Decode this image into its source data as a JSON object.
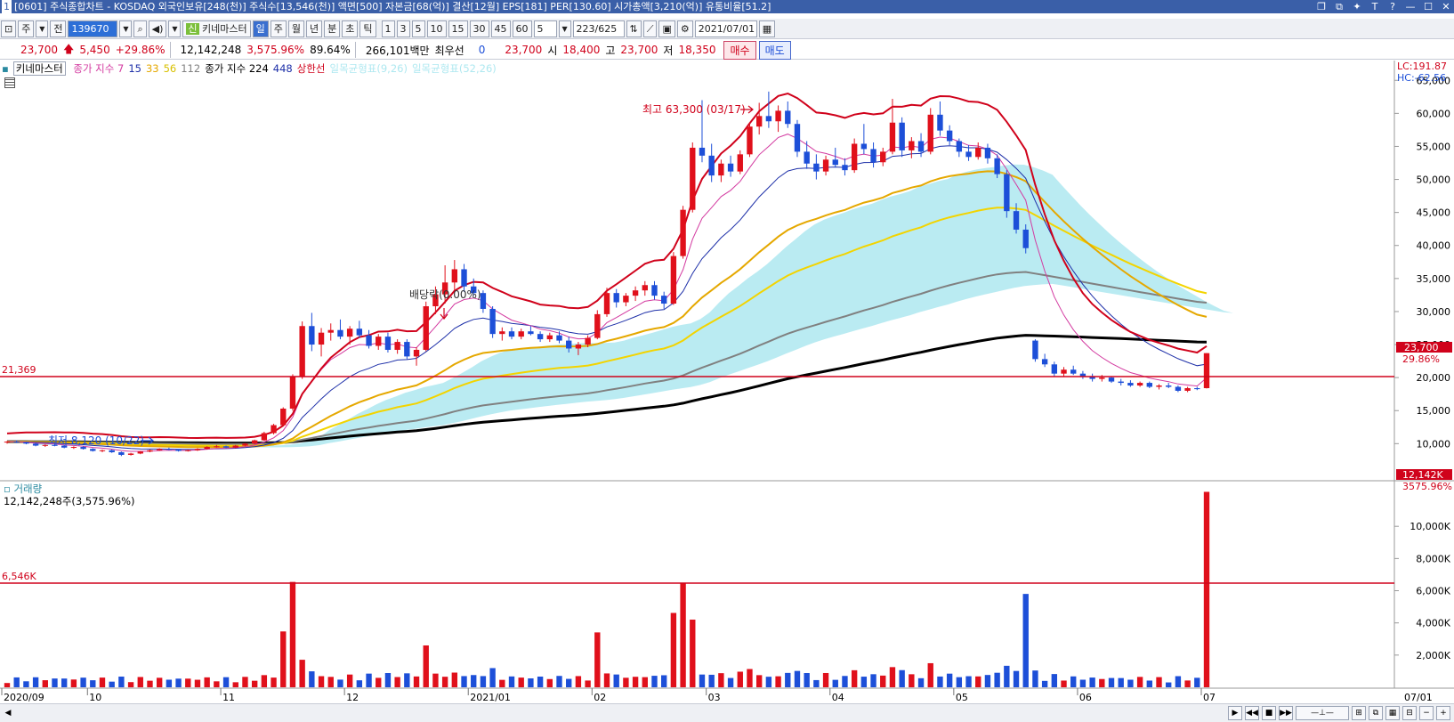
{
  "title_bar": {
    "text": "[0601] 주식종합차트 - KOSDAQ 외국인보유[248(천)] 주식수[13,546(천)] 액면[500] 자본금[68(억)] 결산[12월] EPS[181] PER[130.60] 시가총액[3,210(억)] 유통비율[51.2]",
    "icon": "1"
  },
  "toolbar": {
    "period_label": "주",
    "mode_label": "전",
    "stock_code": "139670",
    "indicator_label": "키네마스터",
    "timeframes": [
      "일",
      "주",
      "월",
      "년",
      "분",
      "초",
      "틱"
    ],
    "active_timeframe": "일",
    "intervals": [
      "1",
      "3",
      "5",
      "10",
      "15",
      "30",
      "45",
      "60"
    ],
    "count_value": "5",
    "range_text": "223/625",
    "date_value": "2021/07/01"
  },
  "quote": {
    "price": "23,700",
    "change": "5,450",
    "change_pct": "+29.86%",
    "volume": "12,142,248",
    "vol_ratio": "3,575.96%",
    "ratio2": "89.64%",
    "amount": "266,101백만",
    "preferred_label": "최우선",
    "preferred_value": "0",
    "current": "23,700",
    "open_label": "시",
    "open": "18,400",
    "high_label": "고",
    "high": "23,700",
    "low_label": "저",
    "low": "18,350",
    "buy_label": "매수",
    "sell_label": "매도"
  },
  "legend": {
    "name": "키네마스터",
    "ma_label": "종가 지수 7",
    "ma15": "15",
    "ma33": "33",
    "ma56": "56",
    "ma112": "112",
    "ma_long_label": "종가 지수 224",
    "ma448": "448",
    "upper_limit_label": "상한선",
    "ichimoku1": "일목균형표(9,26)",
    "ichimoku2": "일목균형표(52,26)",
    "colors": {
      "ma7": "#d33aa0",
      "ma15": "#1d2fa8",
      "ma33": "#e5a800",
      "ma56": "#f3d400",
      "ma112": "#808080",
      "ma224": "#000000",
      "upper": "#d0021b",
      "ichimoku": "#aee8f0"
    }
  },
  "price_axis": {
    "ticks": [
      "65,000",
      "60,000",
      "55,000",
      "50,000",
      "45,000",
      "40,000",
      "35,000",
      "30,000",
      "25,000",
      "20,000",
      "15,000",
      "10,000"
    ],
    "lc": "LC:191.87",
    "hc": "HC:-62.56",
    "current_tag": "23,700",
    "pct_tag": "29.86%",
    "level_line": "21,369"
  },
  "annotations": {
    "high": "최고 63,300 (03/17)",
    "low": "최저 8,120 (10/22)",
    "dividend": "배당락(0.00%)"
  },
  "volume": {
    "label": "거래량",
    "value": "12,142,248주(3,575.96%)",
    "level_line": "6,546K",
    "ticks": [
      "10,000K",
      "8,000K",
      "6,000K",
      "4,000K",
      "2,000K"
    ],
    "current_tag": "12,142K",
    "pct_tag": "3575.96%"
  },
  "x_axis": {
    "labels": [
      "2020/09",
      "10",
      "11",
      "12",
      "2021/01",
      "02",
      "03",
      "04",
      "05",
      "06",
      "07"
    ],
    "right_label": "07/01"
  },
  "chart_data": {
    "type": "candlestick",
    "ylim": [
      6000,
      68000
    ],
    "volume_ylim": [
      0,
      12500
    ],
    "candles": [
      [
        10200,
        10400,
        10000,
        10300
      ],
      [
        10300,
        10500,
        10100,
        10200
      ],
      [
        10200,
        10300,
        9900,
        10000
      ],
      [
        10000,
        10100,
        9600,
        9700
      ],
      [
        9700,
        9900,
        9500,
        9800
      ],
      [
        9800,
        10000,
        9600,
        9700
      ],
      [
        9700,
        9800,
        9300,
        9400
      ],
      [
        9400,
        9600,
        9200,
        9500
      ],
      [
        9500,
        9600,
        9100,
        9200
      ],
      [
        9200,
        9300,
        8800,
        8900
      ],
      [
        8900,
        9100,
        8700,
        9000
      ],
      [
        9000,
        9100,
        8600,
        8700
      ],
      [
        8700,
        8800,
        8120,
        8300
      ],
      [
        8300,
        8600,
        8200,
        8500
      ],
      [
        8500,
        8900,
        8400,
        8800
      ],
      [
        8800,
        9100,
        8700,
        9000
      ],
      [
        9000,
        9300,
        8900,
        9200
      ],
      [
        9200,
        9400,
        9000,
        9100
      ],
      [
        9100,
        9200,
        8800,
        8900
      ],
      [
        8900,
        9100,
        8800,
        9000
      ],
      [
        9000,
        9300,
        8900,
        9200
      ],
      [
        9200,
        9600,
        9100,
        9500
      ],
      [
        9500,
        9800,
        9400,
        9600
      ],
      [
        9600,
        9700,
        9300,
        9400
      ],
      [
        9400,
        9800,
        9300,
        9700
      ],
      [
        9700,
        10100,
        9600,
        10000
      ],
      [
        10000,
        10600,
        9900,
        10500
      ],
      [
        10500,
        11800,
        10400,
        11600
      ],
      [
        11600,
        13000,
        11400,
        12800
      ],
      [
        12800,
        15500,
        12600,
        15300
      ],
      [
        15300,
        20500,
        15000,
        20100
      ],
      [
        20100,
        28500,
        19800,
        27800
      ],
      [
        27800,
        29800,
        24000,
        25000
      ],
      [
        25000,
        27500,
        23200,
        26800
      ],
      [
        26800,
        28200,
        25600,
        27200
      ],
      [
        27200,
        28800,
        25800,
        26200
      ],
      [
        26200,
        27800,
        25000,
        27400
      ],
      [
        27400,
        28600,
        26000,
        26400
      ],
      [
        26400,
        27200,
        24400,
        24800
      ],
      [
        24800,
        26600,
        24200,
        26200
      ],
      [
        26200,
        26800,
        23800,
        24200
      ],
      [
        24200,
        25800,
        23600,
        25400
      ],
      [
        25400,
        25800,
        22800,
        23200
      ],
      [
        23200,
        24600,
        21800,
        24200
      ],
      [
        24200,
        31500,
        24000,
        30800
      ],
      [
        30800,
        33800,
        29600,
        32600
      ],
      [
        32600,
        37000,
        31200,
        34400
      ],
      [
        34400,
        37800,
        33200,
        36400
      ],
      [
        36400,
        37200,
        33000,
        33800
      ],
      [
        33800,
        35000,
        32400,
        32800
      ],
      [
        32800,
        33200,
        29800,
        30400
      ],
      [
        30400,
        30800,
        26000,
        26600
      ],
      [
        26600,
        27600,
        25600,
        27000
      ],
      [
        27000,
        27600,
        25800,
        26200
      ],
      [
        26200,
        27400,
        25800,
        27000
      ],
      [
        27000,
        27800,
        26400,
        26600
      ],
      [
        26600,
        27000,
        25400,
        25800
      ],
      [
        25800,
        26800,
        25400,
        26400
      ],
      [
        26400,
        27000,
        25200,
        25600
      ],
      [
        25600,
        26200,
        23800,
        24400
      ],
      [
        24400,
        25400,
        23400,
        25000
      ],
      [
        25000,
        26400,
        24600,
        26000
      ],
      [
        26000,
        30200,
        25800,
        29600
      ],
      [
        29600,
        33600,
        29200,
        32800
      ],
      [
        32800,
        33400,
        30600,
        31400
      ],
      [
        31400,
        32800,
        30800,
        32400
      ],
      [
        32400,
        33800,
        31600,
        33200
      ],
      [
        33200,
        34600,
        32400,
        34000
      ],
      [
        34000,
        34600,
        31800,
        32400
      ],
      [
        32400,
        33000,
        30400,
        31200
      ],
      [
        31200,
        39000,
        31000,
        38400
      ],
      [
        38400,
        46000,
        38000,
        45400
      ],
      [
        45400,
        55600,
        45000,
        54800
      ],
      [
        54800,
        62000,
        52600,
        53600
      ],
      [
        53600,
        55400,
        49600,
        50600
      ],
      [
        50600,
        53000,
        49600,
        52400
      ],
      [
        52400,
        53600,
        50400,
        51200
      ],
      [
        51200,
        54400,
        50800,
        53800
      ],
      [
        53800,
        58600,
        53400,
        58000
      ],
      [
        58000,
        61600,
        56800,
        59600
      ],
      [
        59600,
        63300,
        57800,
        58800
      ],
      [
        58800,
        61200,
        57200,
        60400
      ],
      [
        60400,
        61800,
        57800,
        58400
      ],
      [
        58400,
        59000,
        53400,
        54200
      ],
      [
        54200,
        55800,
        51600,
        52400
      ],
      [
        52400,
        53800,
        50000,
        51200
      ],
      [
        51200,
        53600,
        50600,
        53000
      ],
      [
        53000,
        54800,
        51800,
        52200
      ],
      [
        52200,
        53200,
        50600,
        51400
      ],
      [
        51400,
        56200,
        51000,
        55400
      ],
      [
        55400,
        58400,
        53800,
        54600
      ],
      [
        54600,
        55600,
        51800,
        52600
      ],
      [
        52600,
        54800,
        52000,
        54200
      ],
      [
        54200,
        62200,
        53800,
        58600
      ],
      [
        58600,
        59400,
        53400,
        54400
      ],
      [
        54400,
        56400,
        53200,
        55800
      ],
      [
        55800,
        57000,
        53400,
        54200
      ],
      [
        54200,
        60800,
        53800,
        59800
      ],
      [
        59800,
        61800,
        56600,
        57400
      ],
      [
        57400,
        58200,
        55200,
        55800
      ],
      [
        55800,
        56200,
        53400,
        54200
      ],
      [
        54200,
        55200,
        52800,
        53400
      ],
      [
        53400,
        55600,
        53000,
        54800
      ],
      [
        54800,
        55400,
        52400,
        53200
      ],
      [
        53200,
        53800,
        50200,
        50800
      ],
      [
        50800,
        51400,
        44200,
        45200
      ],
      [
        45200,
        46400,
        41800,
        42400
      ],
      [
        42400,
        43200,
        38800,
        39600
      ],
      [
        25600,
        25800,
        22400,
        22800
      ],
      [
        22800,
        23600,
        21600,
        22000
      ],
      [
        22000,
        22400,
        20200,
        20600
      ],
      [
        20600,
        21600,
        20200,
        21200
      ],
      [
        21200,
        21800,
        20400,
        20600
      ],
      [
        20600,
        21000,
        19800,
        20200
      ],
      [
        20200,
        20600,
        19400,
        19800
      ],
      [
        19800,
        20400,
        19400,
        20000
      ],
      [
        20000,
        20200,
        19200,
        19400
      ],
      [
        19400,
        19800,
        18800,
        19200
      ],
      [
        19200,
        19600,
        18600,
        18800
      ],
      [
        18800,
        19400,
        18600,
        19200
      ],
      [
        19200,
        19400,
        18400,
        18600
      ],
      [
        18600,
        19000,
        18200,
        18800
      ],
      [
        18800,
        19200,
        18400,
        18600
      ],
      [
        18600,
        18800,
        17800,
        18000
      ],
      [
        18000,
        18600,
        17800,
        18400
      ],
      [
        18400,
        18600,
        18100,
        18250
      ],
      [
        18400,
        23700,
        18350,
        23700
      ]
    ],
    "volumes": [],
    "volume_spikes": {
      "idx30": 6546,
      "idx44": 2600,
      "idx71": 6500,
      "idx108": 5800,
      "last": 12142
    }
  }
}
